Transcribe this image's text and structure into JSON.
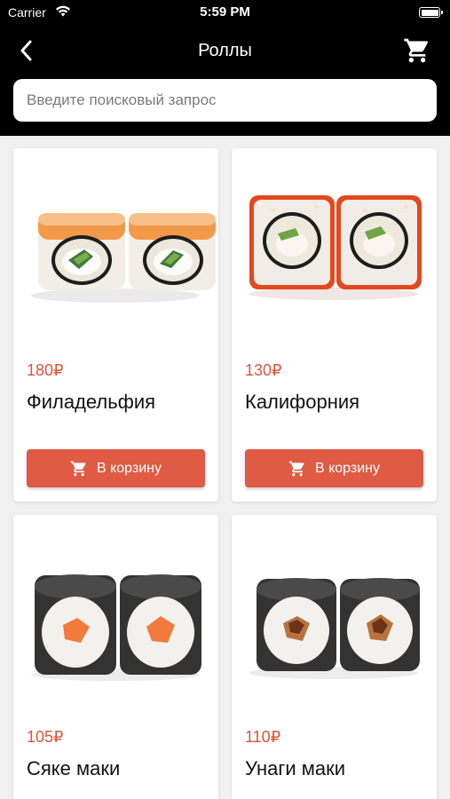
{
  "status_bar": {
    "carrier": "Carrier",
    "time": "5:59 PM"
  },
  "nav": {
    "title": "Роллы",
    "back_icon": "chevron-left-icon",
    "cart_icon": "cart-icon"
  },
  "search": {
    "placeholder": "Введите поисковый запрос",
    "value": ""
  },
  "colors": {
    "price": "#e2523a",
    "button": "#e05a44",
    "header": "#000000"
  },
  "products": [
    {
      "price": "180₽",
      "name": "Филадельфия",
      "button_label": "В корзину"
    },
    {
      "price": "130₽",
      "name": "Калифорния",
      "button_label": "В корзину"
    },
    {
      "price": "105₽",
      "name": "Сяке маки"
    },
    {
      "price": "110₽",
      "name": "Унаги маки"
    }
  ]
}
